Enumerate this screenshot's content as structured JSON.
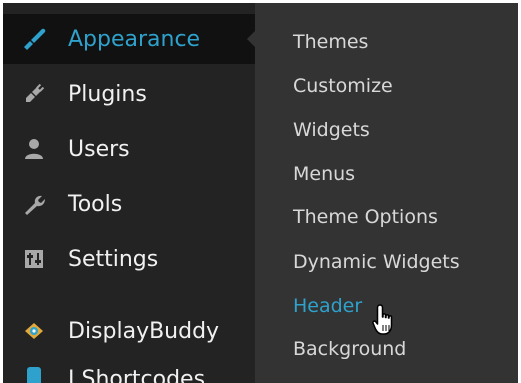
{
  "sidebar": {
    "items": [
      {
        "label": "Appearance",
        "icon": "paintbrush-icon"
      },
      {
        "label": "Plugins",
        "icon": "plugin-icon"
      },
      {
        "label": "Users",
        "icon": "user-icon"
      },
      {
        "label": "Tools",
        "icon": "wrench-icon"
      },
      {
        "label": "Settings",
        "icon": "settings-icon"
      },
      {
        "label": "DisplayBuddy",
        "icon": "eye-icon"
      },
      {
        "label": "J Shortcodes",
        "icon": "shortcodes-icon"
      }
    ]
  },
  "submenu": {
    "items": [
      {
        "label": "Themes"
      },
      {
        "label": "Customize"
      },
      {
        "label": "Widgets"
      },
      {
        "label": "Menus"
      },
      {
        "label": "Theme Options"
      },
      {
        "label": "Dynamic Widgets"
      },
      {
        "label": "Header"
      },
      {
        "label": "Background"
      }
    ],
    "current": "Header"
  },
  "colors": {
    "sidebar_bg": "#232323",
    "active_bg": "#111111",
    "submenu_bg": "#333333",
    "accent": "#2ea2cc",
    "text": "#f1f1f1",
    "submenu_text": "#d8d8d8"
  }
}
